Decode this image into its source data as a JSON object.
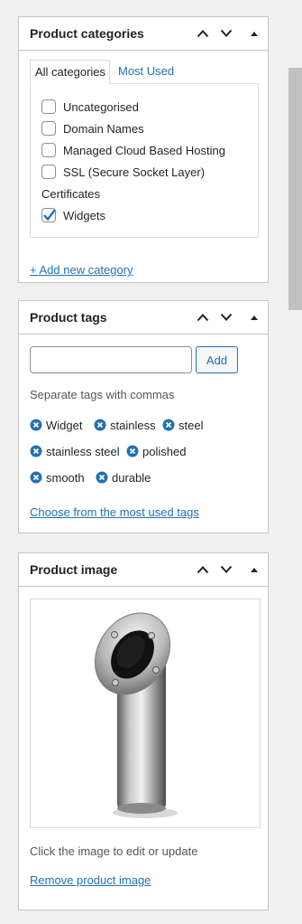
{
  "categories_box": {
    "title": "Product categories",
    "tabs": [
      {
        "label": "All categories"
      },
      {
        "label": "Most Used"
      }
    ],
    "items": [
      {
        "label": "Uncategorised",
        "checked": false
      },
      {
        "label": "Domain Names",
        "checked": false
      },
      {
        "label": "Managed Cloud Based Hosting",
        "checked": false
      },
      {
        "label": "SSL (Secure Socket Layer)",
        "checked": false
      }
    ],
    "group_heading": "Certificates",
    "group_items": [
      {
        "label": "Widgets",
        "checked": true
      }
    ],
    "add_new_label": "+ Add new category"
  },
  "tags_box": {
    "title": "Product tags",
    "input_value": "",
    "add_button_label": "Add",
    "hint": "Separate tags with commas",
    "tags": [
      "Widget",
      "stainless",
      "steel",
      "stainless steel",
      "polished",
      "smooth",
      "durable"
    ],
    "choose_link": "Choose from the most used tags"
  },
  "image_box": {
    "title": "Product image",
    "hint": "Click the image to edit or update",
    "remove_link": "Remove product image"
  },
  "icons": {
    "move_up": "chevron-up-icon",
    "move_down": "chevron-down-icon",
    "toggle": "triangle-up-icon",
    "tag_remove": "remove-circle-icon",
    "checkmark": "checkmark-icon"
  },
  "colors": {
    "link": "#2271b1",
    "border": "#c3c4c7",
    "background": "#f0f0f1",
    "text": "#1d2327"
  }
}
